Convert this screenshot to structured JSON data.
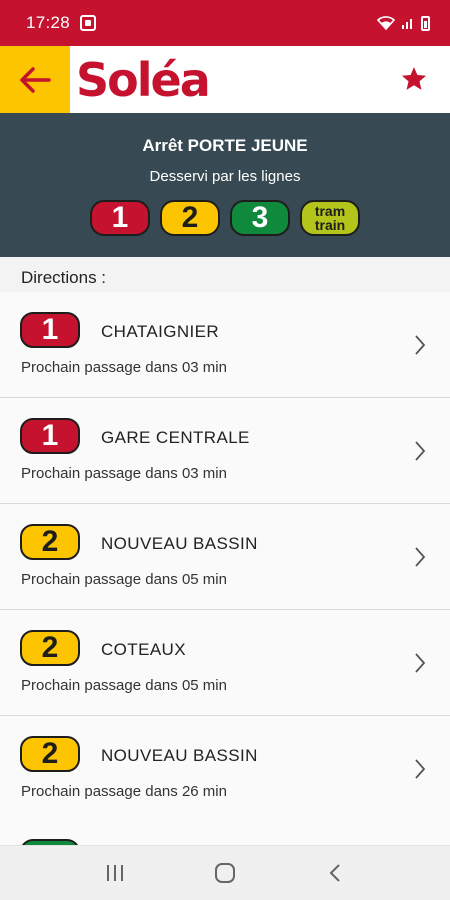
{
  "status_bar": {
    "time": "17:28"
  },
  "header": {
    "brand": "Soléa"
  },
  "stop": {
    "title": "Arrêt PORTE JEUNE",
    "subtitle": "Desservi par les lignes",
    "lines": [
      {
        "label": "1",
        "color": "#c4122f"
      },
      {
        "label": "2",
        "color": "#fdc400"
      },
      {
        "label": "3",
        "color": "#0f8a3c"
      },
      {
        "label_top": "tram",
        "label_bottom": "train",
        "color": "#b3c41a"
      }
    ]
  },
  "directions": {
    "label": "Directions :",
    "items": [
      {
        "line": "1",
        "name": "CHATAIGNIER",
        "next": "Prochain passage dans 03 min"
      },
      {
        "line": "1",
        "name": "GARE CENTRALE",
        "next": "Prochain passage dans 03 min"
      },
      {
        "line": "2",
        "name": "NOUVEAU BASSIN",
        "next": "Prochain passage dans 05 min"
      },
      {
        "line": "2",
        "name": "COTEAUX",
        "next": "Prochain passage dans 05 min"
      },
      {
        "line": "2",
        "name": "NOUVEAU BASSIN",
        "next": "Prochain passage dans 26 min"
      }
    ]
  },
  "icons": {
    "back": "arrow-left-icon",
    "favorite": "star-icon",
    "chevron": "chevron-right-icon",
    "nav": [
      "recent-apps-icon",
      "home-icon",
      "back-icon"
    ]
  },
  "colors": {
    "brand_red": "#c4122f",
    "brand_yellow": "#fdc400",
    "banner": "#374a53"
  }
}
